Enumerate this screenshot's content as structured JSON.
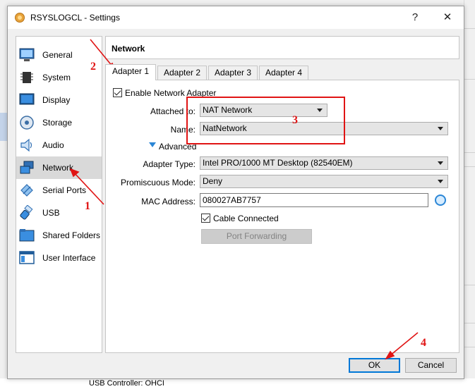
{
  "window": {
    "title": "RSYSLOGCL - Settings",
    "help_glyph": "?",
    "close_glyph": "✕"
  },
  "sidebar": {
    "items": [
      {
        "label": "General",
        "icon": "monitor-icon"
      },
      {
        "label": "System",
        "icon": "chip-icon"
      },
      {
        "label": "Display",
        "icon": "display-icon"
      },
      {
        "label": "Storage",
        "icon": "disk-icon"
      },
      {
        "label": "Audio",
        "icon": "speaker-icon"
      },
      {
        "label": "Network",
        "icon": "network-icon",
        "selected": true
      },
      {
        "label": "Serial Ports",
        "icon": "serial-port-icon"
      },
      {
        "label": "USB",
        "icon": "usb-icon"
      },
      {
        "label": "Shared Folders",
        "icon": "folder-icon"
      },
      {
        "label": "User Interface",
        "icon": "window-icon"
      }
    ]
  },
  "page": {
    "title": "Network"
  },
  "tabs": [
    {
      "label": "Adapter 1",
      "active": true
    },
    {
      "label": "Adapter 2"
    },
    {
      "label": "Adapter 3"
    },
    {
      "label": "Adapter 4"
    }
  ],
  "adapter": {
    "enable_label": "Enable Network Adapter",
    "enable_checked": true,
    "attached_label": "Attached to:",
    "attached_value": "NAT Network",
    "name_label": "Name:",
    "name_value": "NatNetwork",
    "advanced_label": "Advanced",
    "type_label": "Adapter Type:",
    "type_value": "Intel PRO/1000 MT Desktop (82540EM)",
    "promisc_label": "Promiscuous Mode:",
    "promisc_value": "Deny",
    "mac_label": "MAC Address:",
    "mac_value": "080027AB7757",
    "cable_label": "Cable Connected",
    "cable_checked": true,
    "port_forwarding_label": "Port Forwarding"
  },
  "footer": {
    "ok_label": "OK",
    "cancel_label": "Cancel"
  },
  "background": {
    "status_text": "USB Controller:   OHCI"
  },
  "annotations": {
    "n1": "1",
    "n2": "2",
    "n3": "3",
    "n4": "4",
    "color": "#e01414"
  },
  "colors": {
    "accent": "#0078d7",
    "selected_bg": "#d9d9d9"
  }
}
